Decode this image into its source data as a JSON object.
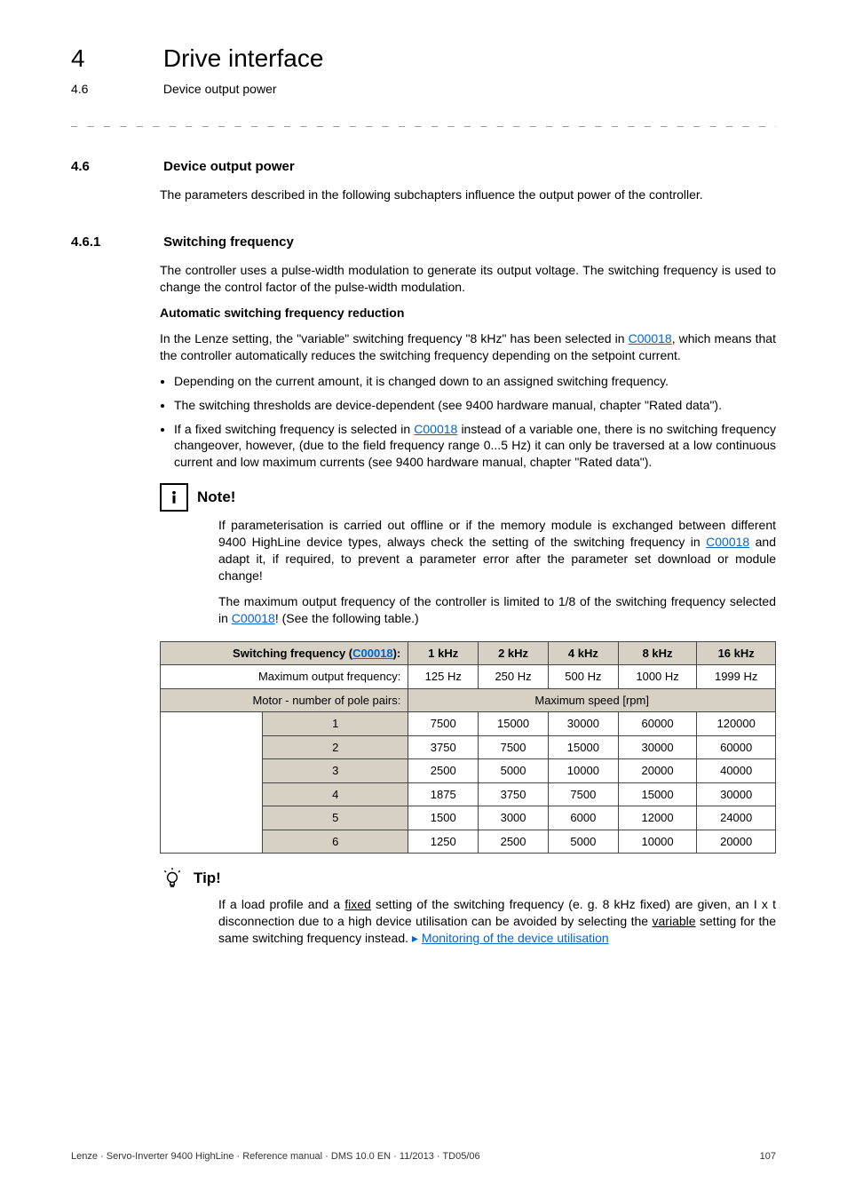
{
  "header": {
    "chapter_num": "4",
    "chapter_title": "Drive interface",
    "sub_num": "4.6",
    "sub_title": "Device output power"
  },
  "sec_4_6": {
    "num": "4.6",
    "title": "Device output power",
    "para": "The parameters described in the following subchapters influence the output power of the controller."
  },
  "sec_4_6_1": {
    "num": "4.6.1",
    "title": "Switching frequency",
    "para": "The controller uses a pulse-width modulation to generate its output voltage. The switching frequency is used to change the control factor of the pulse-width modulation.",
    "sub_heading": "Automatic switching frequency reduction",
    "auto_pre": "In the Lenze setting, the \"variable\" switching frequency \"8 kHz\" has been selected in ",
    "auto_link": "C00018",
    "auto_post": ", which means that the controller automatically reduces the switching frequency depending on the setpoint current.",
    "bullet1": "Depending on the current amount, it is changed down to an assigned switching frequency.",
    "bullet2": "The switching thresholds are device-dependent (see 9400 hardware manual, chapter \"Rated data\").",
    "bullet3_pre": "If a fixed switching frequency is selected in ",
    "bullet3_link": "C00018",
    "bullet3_post": " instead of a variable one, there is no switching frequency changeover, however, (due to the field frequency range 0...5 Hz) it can only be traversed at a low continuous current and low maximum currents (see 9400 hardware manual, chapter \"Rated data\")."
  },
  "note": {
    "title": "Note!",
    "p1_pre": "If parameterisation is carried out offline or if the memory module is exchanged between different 9400 HighLine device types, always check the setting of the switching frequency in ",
    "p1_link": "C00018",
    "p1_post": " and adapt it, if required, to prevent a parameter error after the parameter set download or module change!",
    "p2_pre": "The maximum output frequency of the controller is limited to 1/8 of the switching frequency selected in ",
    "p2_link": "C00018",
    "p2_post": "! (See the following table.)"
  },
  "table": {
    "head_label_pre": "Switching frequency (",
    "head_label_link": "C00018",
    "head_label_post": "):",
    "cols": [
      "1 kHz",
      "2 kHz",
      "4 kHz",
      "8 kHz",
      "16 kHz"
    ],
    "row_maxout_label": "Maximum output frequency:",
    "row_maxout": [
      "125 Hz",
      "250 Hz",
      "500 Hz",
      "1000 Hz",
      "1999 Hz"
    ],
    "row_pole_label": "Motor - number of pole pairs:",
    "row_pole_span": "Maximum speed [rpm]",
    "pairs": [
      "1",
      "2",
      "3",
      "4",
      "5",
      "6"
    ],
    "speed": {
      "1": [
        "7500",
        "15000",
        "30000",
        "60000",
        "120000"
      ],
      "2": [
        "3750",
        "7500",
        "15000",
        "30000",
        "60000"
      ],
      "3": [
        "2500",
        "5000",
        "10000",
        "20000",
        "40000"
      ],
      "4": [
        "1875",
        "3750",
        "7500",
        "15000",
        "30000"
      ],
      "5": [
        "1500",
        "3000",
        "6000",
        "12000",
        "24000"
      ],
      "6": [
        "1250",
        "2500",
        "5000",
        "10000",
        "20000"
      ]
    }
  },
  "tip": {
    "title": "Tip!",
    "pre": "If a load profile and a ",
    "u1": "fixed",
    "mid1": " setting of the switching frequency (e. g. 8 kHz fixed) are given, an I x t disconnection due to a high device utilisation can be avoided by selecting the ",
    "u2": "variable",
    "mid2": " setting for the same switching frequency instead.  ",
    "arrow": "▸",
    "link": "Monitoring of the device utilisation"
  },
  "footer": {
    "left": "Lenze · Servo-Inverter 9400 HighLine · Reference manual · DMS 10.0 EN · 11/2013 · TD05/06",
    "right": "107"
  },
  "chart_data": {
    "type": "table",
    "title": "Maximum speed [rpm] by switching frequency and number of pole pairs",
    "columns": [
      "1 kHz",
      "2 kHz",
      "4 kHz",
      "8 kHz",
      "16 kHz"
    ],
    "max_output_frequency_hz": [
      125,
      250,
      500,
      1000,
      1999
    ],
    "rows": [
      {
        "pole_pairs": 1,
        "values": [
          7500,
          15000,
          30000,
          60000,
          120000
        ]
      },
      {
        "pole_pairs": 2,
        "values": [
          3750,
          7500,
          15000,
          30000,
          60000
        ]
      },
      {
        "pole_pairs": 3,
        "values": [
          2500,
          5000,
          10000,
          20000,
          40000
        ]
      },
      {
        "pole_pairs": 4,
        "values": [
          1875,
          3750,
          7500,
          15000,
          30000
        ]
      },
      {
        "pole_pairs": 5,
        "values": [
          1500,
          3000,
          6000,
          12000,
          24000
        ]
      },
      {
        "pole_pairs": 6,
        "values": [
          1250,
          2500,
          5000,
          10000,
          20000
        ]
      }
    ]
  }
}
